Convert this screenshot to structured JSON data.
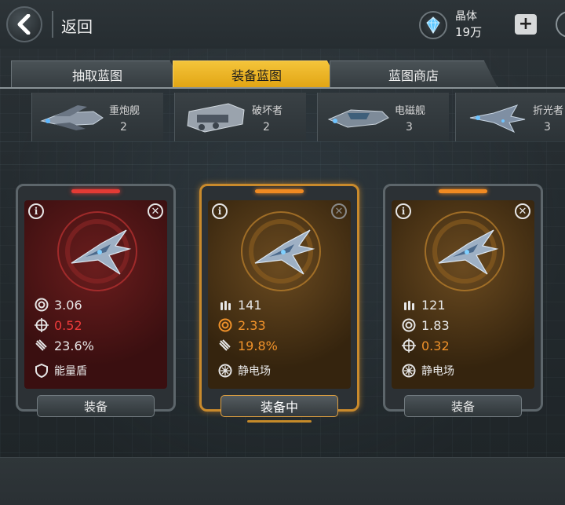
{
  "header": {
    "back_label": "返回",
    "currency": {
      "name": "晶体",
      "amount": "19万",
      "icon": "crystal-icon"
    },
    "plus_label": "+"
  },
  "tabs": [
    {
      "label": "抽取蓝图",
      "active": false
    },
    {
      "label": "装备蓝图",
      "active": true
    },
    {
      "label": "蓝图商店",
      "active": false
    }
  ],
  "categories": [
    {
      "name": "重炮舰",
      "count": "2"
    },
    {
      "name": "破坏者",
      "count": "2"
    },
    {
      "name": "电磁舰",
      "count": "3"
    },
    {
      "name": "折光者",
      "count": "3"
    }
  ],
  "cards": [
    {
      "theme": "red",
      "selected": false,
      "stats": [
        {
          "icon": "target-ring-icon",
          "value": "3.06",
          "color": "normal"
        },
        {
          "icon": "crosshair-icon",
          "value": "0.52",
          "color": "red"
        },
        {
          "icon": "missile-icon",
          "value": "23.6%",
          "color": "normal"
        }
      ],
      "skill": {
        "icon": "shield-icon",
        "label": "能量盾"
      },
      "button": "装备"
    },
    {
      "theme": "orange",
      "selected": true,
      "stats": [
        {
          "icon": "ammo-icon",
          "value": "141",
          "color": "normal"
        },
        {
          "icon": "target-ring-icon",
          "value": "2.33",
          "color": "orange"
        },
        {
          "icon": "missile-icon",
          "value": "19.8%",
          "color": "orange"
        }
      ],
      "skill": {
        "icon": "static-field-icon",
        "label": "静电场"
      },
      "button": "装备中"
    },
    {
      "theme": "orange",
      "selected": false,
      "stats": [
        {
          "icon": "ammo-icon",
          "value": "121",
          "color": "normal"
        },
        {
          "icon": "target-ring-icon",
          "value": "1.83",
          "color": "normal"
        },
        {
          "icon": "crosshair-icon",
          "value": "0.32",
          "color": "orange"
        }
      ],
      "skill": {
        "icon": "static-field-icon",
        "label": "静电场"
      },
      "button": "装备"
    }
  ],
  "colors": {
    "accent_yellow": "#f4c43a",
    "stat_red": "#ef3b3b",
    "stat_orange": "#f0922a"
  }
}
